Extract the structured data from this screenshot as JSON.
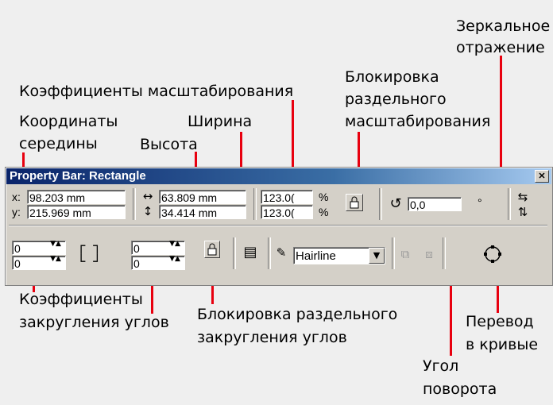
{
  "annotations": {
    "coords": [
      "Координаты",
      "середины"
    ],
    "scale": "Коэффициенты масштабирования",
    "width": "Ширина",
    "height": "Высота",
    "lock_scale": [
      "Блокировка",
      "раздельного",
      "масштабирования"
    ],
    "mirror": [
      "Зеркальное",
      "отражение"
    ],
    "corner_round": [
      "Коэффициенты",
      "закругления углов"
    ],
    "lock_round": [
      "Блокировка раздельного",
      "закругления углов"
    ],
    "rotation": [
      "Угол",
      "поворота"
    ],
    "to_curves": [
      "Перевод",
      "в кривые"
    ]
  },
  "toolbar": {
    "title": "Property Bar: Rectangle",
    "close_glyph": "✕",
    "x_label": "x:",
    "y_label": "y:",
    "x_value": "98.203 mm",
    "y_value": "215.969 mm",
    "width_value": "63.809 mm",
    "height_value": "34.414 mm",
    "scale_x": "123.0(",
    "scale_y": "123.0(",
    "percent": "%",
    "rotation_value": "0,0",
    "degree": "°",
    "corner_tl": "0",
    "corner_bl": "0",
    "corner_tr": "0",
    "corner_br": "0",
    "outline": "Hairline"
  },
  "colors": {
    "accent": "#e8000f",
    "titlebar": "#0a246a",
    "panel": "#d4d0c8"
  }
}
